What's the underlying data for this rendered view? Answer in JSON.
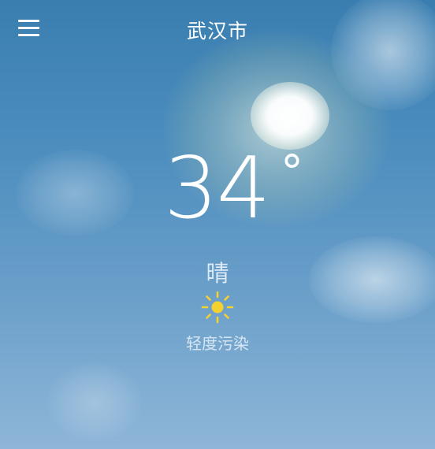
{
  "header": {
    "city": "武汉市",
    "menu_icon": "hamburger-menu-icon"
  },
  "current": {
    "temperature": "34",
    "unit": "°",
    "condition": "晴",
    "condition_icon": "sun-icon",
    "air_quality": "轻度污染"
  },
  "colors": {
    "sky_top": "#3a7eb0",
    "sky_bottom": "#8eb6d8",
    "sun_icon": "#f5d130",
    "text": "#ffffff"
  }
}
